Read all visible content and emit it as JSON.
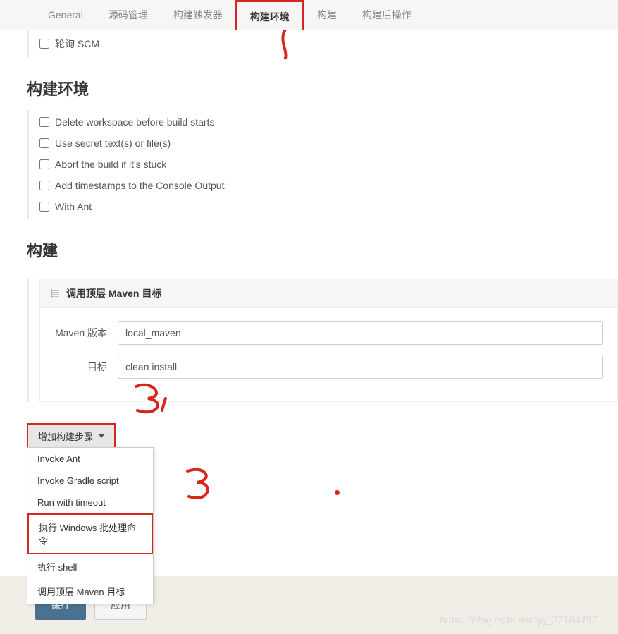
{
  "tabs": {
    "items": [
      {
        "label": "General"
      },
      {
        "label": "源码管理"
      },
      {
        "label": "构建触发器"
      },
      {
        "label": "构建环境"
      },
      {
        "label": "构建"
      },
      {
        "label": "构建后操作"
      }
    ]
  },
  "scm_poll": {
    "label": "轮询 SCM"
  },
  "build_env": {
    "title": "构建环境",
    "options": [
      {
        "label": "Delete workspace before build starts"
      },
      {
        "label": "Use secret text(s) or file(s)"
      },
      {
        "label": "Abort the build if it's stuck"
      },
      {
        "label": "Add timestamps to the Console Output"
      },
      {
        "label": "With Ant"
      }
    ]
  },
  "build": {
    "title": "构建",
    "maven_panel_title": "调用顶层 Maven 目标",
    "maven_version_label": "Maven 版本",
    "maven_version_value": "local_maven",
    "goals_label": "目标",
    "goals_value": "clean install",
    "add_step_button": "增加构建步骤",
    "menu_items": [
      {
        "label": "Invoke Ant"
      },
      {
        "label": "Invoke Gradle script"
      },
      {
        "label": "Run with timeout"
      },
      {
        "label": "执行 Windows 批处理命令"
      },
      {
        "label": "执行 shell"
      },
      {
        "label": "调用顶层 Maven 目标"
      }
    ]
  },
  "buttons": {
    "save": "保存",
    "apply": "应用"
  },
  "watermark": "https://blog.csdn.net/qq_27184497"
}
